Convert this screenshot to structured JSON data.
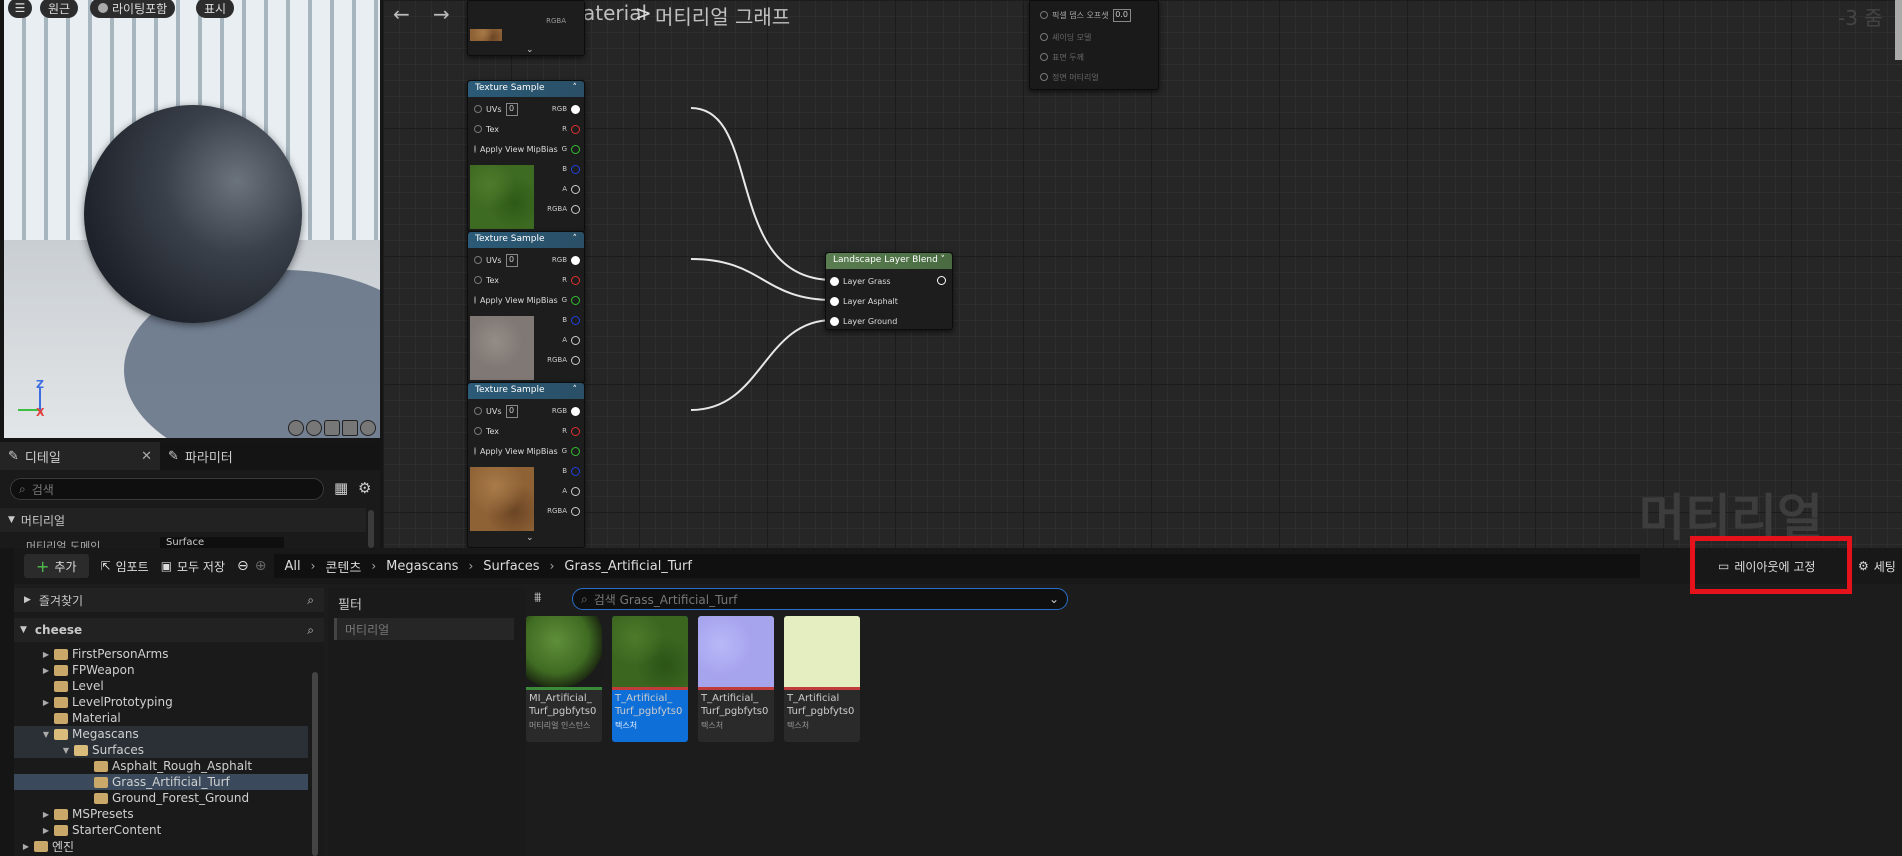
{
  "viewport": {
    "menu_icon": "hamburger-icon",
    "perspective_label": "원근",
    "lit_label": "라이팅포함",
    "show_label": "표시",
    "axis_z": "Z",
    "axis_x": "X"
  },
  "graph": {
    "asset_name": "LandMaterial",
    "breadcrumb_sep": ">",
    "graph_name": "머티리얼 그래프",
    "zoom": "-3 줌",
    "watermark": "머티리얼",
    "texture_nodes": [
      {
        "title": "Texture Sample",
        "uv_label": "UVs",
        "uv_value": "0",
        "tex_label": "Tex",
        "mip_label": "Apply View MipBias",
        "rgb": "RGB",
        "r": "R",
        "g": "G",
        "b": "B",
        "a": "A",
        "rgba": "RGBA"
      },
      {
        "title": "Texture Sample",
        "uv_label": "UVs",
        "uv_value": "0",
        "tex_label": "Tex",
        "mip_label": "Apply View MipBias",
        "rgb": "RGB",
        "r": "R",
        "g": "G",
        "b": "B",
        "a": "A",
        "rgba": "RGBA"
      },
      {
        "title": "Texture Sample",
        "uv_label": "UVs",
        "uv_value": "0",
        "tex_label": "Tex",
        "mip_label": "Apply View MipBias",
        "rgb": "RGB",
        "r": "R",
        "g": "G",
        "b": "B",
        "a": "A",
        "rgba": "RGBA"
      }
    ],
    "blend_node": {
      "title": "Landscape Layer Blend",
      "layers": [
        "Layer Grass",
        "Layer Asphalt",
        "Layer Ground"
      ]
    },
    "top_node_rgba": "RGBA",
    "main_node_rows": [
      "픽셀 뎁스 오프셋",
      "셰이딩 모델",
      "표면 두께",
      "정면 머티리얼"
    ],
    "main_node_value": "0.0"
  },
  "details": {
    "tab_details": "디테일",
    "tab_params": "파라미터",
    "search_placeholder": "검색",
    "section": "머티리얼",
    "prop_label": "머티리얼 도메인",
    "prop_value": "Surface"
  },
  "content_browser": {
    "add_label": "추가",
    "import_label": "임포트",
    "save_all_label": "모두 저장",
    "breadcrumbs": [
      "All",
      "콘텐츠",
      "Megascans",
      "Surfaces",
      "Grass_Artificial_Turf"
    ],
    "dock_label": "레이아웃에 고정",
    "settings_label": "세팅",
    "favorites_label": "즐겨찾기",
    "project_label": "cheese",
    "tree": [
      {
        "label": "FirstPersonArms",
        "depth": 1,
        "expand": "▶",
        "selected": false
      },
      {
        "label": "FPWeapon",
        "depth": 1,
        "expand": "▶",
        "selected": false
      },
      {
        "label": "Level",
        "depth": 1,
        "expand": "",
        "selected": false
      },
      {
        "label": "LevelPrototyping",
        "depth": 1,
        "expand": "▶",
        "selected": false
      },
      {
        "label": "Material",
        "depth": 1,
        "expand": "",
        "selected": false
      },
      {
        "label": "Megascans",
        "depth": 1,
        "expand": "▼",
        "selected": false
      },
      {
        "label": "Surfaces",
        "depth": 2,
        "expand": "▼",
        "selected": false
      },
      {
        "label": "Asphalt_Rough_Asphalt",
        "depth": 3,
        "expand": "",
        "selected": false
      },
      {
        "label": "Grass_Artificial_Turf",
        "depth": 3,
        "expand": "",
        "selected": true
      },
      {
        "label": "Ground_Forest_Ground",
        "depth": 3,
        "expand": "",
        "selected": false
      },
      {
        "label": "MSPresets",
        "depth": 1,
        "expand": "▶",
        "selected": false
      },
      {
        "label": "StarterContent",
        "depth": 1,
        "expand": "▶",
        "selected": false
      },
      {
        "label": "엔진",
        "depth": 0,
        "expand": "▶",
        "selected": false
      }
    ],
    "filter_title": "필터",
    "filter_item": "머티리얼",
    "asset_search_placeholder": "검색 Grass_Artificial_Turf",
    "assets": [
      {
        "name_l1": "MI_Artificial_",
        "name_l2": "Turf_pgbfyts0",
        "type": "머티리얼 인스턴스",
        "kind": "sphere",
        "selected": false,
        "bar": "#3a8a3a"
      },
      {
        "name_l1": "T_Artificial_",
        "name_l2": "Turf_pgbfyts0",
        "type": "텍스처",
        "kind": "grass",
        "selected": true,
        "bar": "#c23b3b"
      },
      {
        "name_l1": "T_Artificial_",
        "name_l2": "Turf_pgbfyts0",
        "type": "텍스처",
        "kind": "normal",
        "selected": false,
        "bar": "#c23b3b"
      },
      {
        "name_l1": "T_Artificial",
        "name_l2": "Turf_pgbfyts0",
        "type": "텍스처",
        "kind": "pale",
        "selected": false,
        "bar": "#c23b3b"
      }
    ]
  }
}
